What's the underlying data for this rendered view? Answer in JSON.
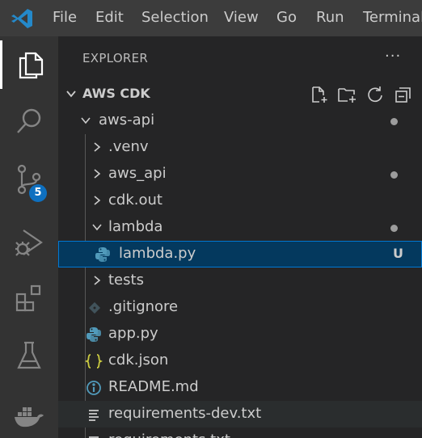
{
  "menu": [
    "File",
    "Edit",
    "Selection",
    "View",
    "Go",
    "Run",
    "Terminal"
  ],
  "activity_bar": {
    "items": [
      "explorer-icon",
      "search-icon",
      "source-control-icon",
      "run-debug-icon",
      "extensions-icon",
      "testing-icon",
      "docker-icon"
    ],
    "active": "explorer-icon",
    "source_control_badge": "5"
  },
  "explorer": {
    "title": "EXPLORER",
    "more_label": "···",
    "section_title": "AWS CDK",
    "section_actions": [
      "new-file-icon",
      "new-folder-icon",
      "refresh-icon",
      "collapse-all-icon"
    ],
    "tree": [
      {
        "label": "aws-api",
        "type": "folder",
        "expanded": true,
        "modified_dot": true
      },
      {
        "label": ".venv",
        "type": "folder",
        "expanded": false
      },
      {
        "label": "aws_api",
        "type": "folder",
        "expanded": false,
        "modified_dot": true
      },
      {
        "label": "cdk.out",
        "type": "folder",
        "expanded": false
      },
      {
        "label": "lambda",
        "type": "folder",
        "expanded": true,
        "modified_dot": true
      },
      {
        "label": "lambda.py",
        "type": "python",
        "selected": true,
        "git_status": "U"
      },
      {
        "label": "tests",
        "type": "folder",
        "expanded": false
      },
      {
        "label": ".gitignore",
        "type": "git"
      },
      {
        "label": "app.py",
        "type": "python"
      },
      {
        "label": "cdk.json",
        "type": "json"
      },
      {
        "label": "README.md",
        "type": "info"
      },
      {
        "label": "requirements-dev.txt",
        "type": "text"
      },
      {
        "label": "requirements.txt",
        "type": "text"
      }
    ]
  },
  "colors": {
    "titlebar": "#3c3c3c",
    "activity_bar": "#333333",
    "sidebar": "#252526",
    "selection": "#04395e",
    "selection_border": "#0078d4",
    "badge": "#0e70c0",
    "python_icon": "#519aba",
    "json_icon": "#cbcb41",
    "git_icon": "#41535b",
    "info_icon": "#519aba"
  }
}
